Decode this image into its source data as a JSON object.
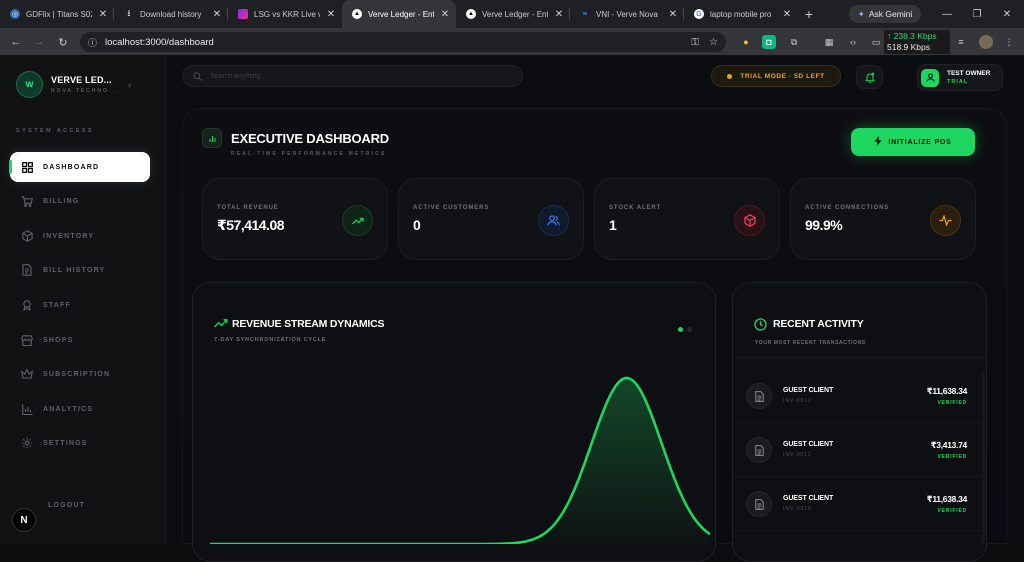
{
  "browser": {
    "tabs": [
      {
        "title": "GDFlix | Titans S02",
        "favicon_color": "#2b6cb0",
        "active": false
      },
      {
        "title": "Download history",
        "favicon_color": "#3c3c3c",
        "active": false
      },
      {
        "title": "LSG vs KKR Live vo",
        "favicon_color": "#7b2ff7",
        "active": false
      },
      {
        "title": "Verve Ledger - Ent",
        "favicon_color": "#000000",
        "active": true
      },
      {
        "title": "Verve Ledger - Ent",
        "favicon_color": "#000000",
        "active": false
      },
      {
        "title": "VNI - Verve Nova",
        "favicon_color": "#1d4ed8",
        "active": false
      },
      {
        "title": "laptop mobile pro",
        "favicon_color": "#ffffff",
        "active": false
      }
    ],
    "ask_gemini": "Ask Gemini",
    "url": "localhost:3000/dashboard",
    "net_up": "↑ 238.3 Kbps",
    "net_down": "518.9 Kbps"
  },
  "sidebar": {
    "brand_name": "VERVE LED...",
    "brand_sub": "NOVA TECHNO...",
    "section_label": "SYSTEM ACCESS",
    "items": [
      {
        "label": "DASHBOARD",
        "icon": "grid-icon",
        "active": true
      },
      {
        "label": "BILLING",
        "icon": "cart-icon",
        "active": false
      },
      {
        "label": "INVENTORY",
        "icon": "box-icon",
        "active": false
      },
      {
        "label": "BILL HISTORY",
        "icon": "document-icon",
        "active": false
      },
      {
        "label": "STAFF",
        "icon": "badge-icon",
        "active": false
      },
      {
        "label": "SHOPS",
        "icon": "store-icon",
        "active": false
      },
      {
        "label": "SUBSCRIPTION",
        "icon": "crown-icon",
        "active": false
      },
      {
        "label": "ANALYTICS",
        "icon": "bar-chart-icon",
        "active": false
      },
      {
        "label": "SETTINGS",
        "icon": "gear-icon",
        "active": false
      }
    ],
    "logout_label": "LOGOUT",
    "badge_letter": "N"
  },
  "topbar": {
    "search_placeholder": "Search anything...",
    "trial_label": "TRIAL MODE · 5D LEFT",
    "user_name": "TEST OWNER",
    "user_role": "TRIAL"
  },
  "dashboard": {
    "title": "EXECUTIVE DASHBOARD",
    "subtitle": "REAL-TIME PERFORMANCE METRICS",
    "init_button": "INITIALIZE POS",
    "stats": [
      {
        "label": "TOTAL REVENUE",
        "value": "₹57,414.08",
        "icon": "trend-up-icon",
        "color": "#1ed760"
      },
      {
        "label": "ACTIVE CUSTOMERS",
        "value": "0",
        "icon": "users-icon",
        "color": "#3b82f6"
      },
      {
        "label": "STOCK ALERT",
        "value": "1",
        "icon": "cube-icon",
        "color": "#f43f5e"
      },
      {
        "label": "ACTIVE CONNECTIONS",
        "value": "99.9%",
        "icon": "pulse-icon",
        "color": "#f59e0b"
      }
    ],
    "revenue_chart": {
      "title": "REVENUE STREAM DYNAMICS",
      "subtitle": "7-DAY SYNCHRONIZATION CYCLE"
    },
    "recent": {
      "title": "RECENT ACTIVITY",
      "subtitle": "YOUR MOST RECENT TRANSACTIONS",
      "items": [
        {
          "name": "GUEST CLIENT",
          "invoice": "INV-0012",
          "amount": "₹11,638.34",
          "status": "VERIFIED"
        },
        {
          "name": "GUEST CLIENT",
          "invoice": "INV-0011",
          "amount": "₹3,413.74",
          "status": "VERIFIED"
        },
        {
          "name": "GUEST CLIENT",
          "invoice": "INV-0010",
          "amount": "₹11,638.34",
          "status": "VERIFIED"
        }
      ]
    }
  },
  "chart_data": {
    "type": "area",
    "x": [
      0,
      1,
      2,
      3,
      4,
      5,
      6
    ],
    "values": [
      0,
      0,
      0,
      0,
      0,
      11638.34,
      0
    ],
    "xlabel": "",
    "ylabel": "",
    "grid": false,
    "color": "#1ed760"
  }
}
